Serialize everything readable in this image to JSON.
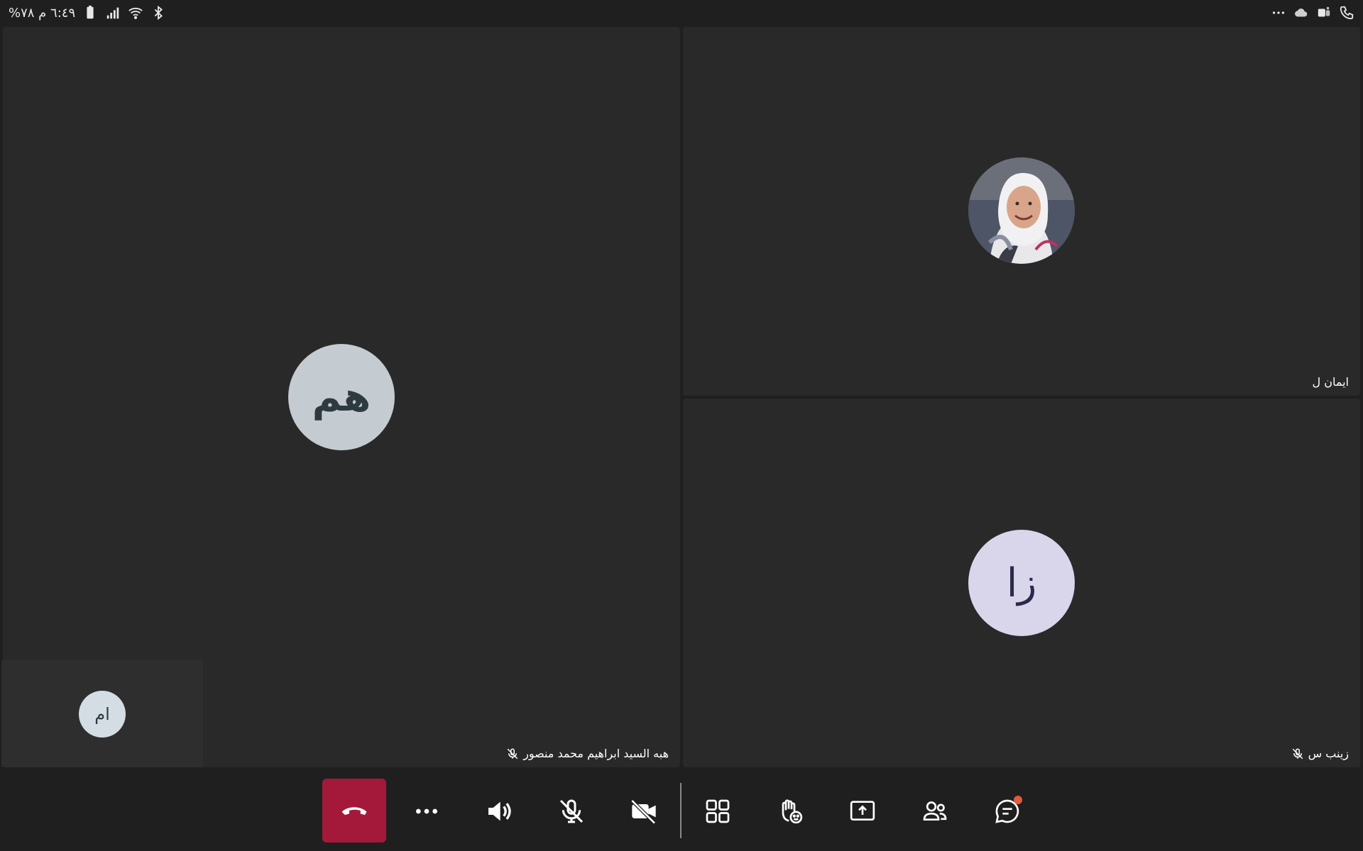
{
  "status_bar": {
    "left_text": "٦:٤٩ م  ٧٨%",
    "icons": [
      "bluetooth-icon",
      "wifi-icon",
      "signal-icon",
      "battery-icon"
    ],
    "right_icons": [
      "phone-icon",
      "teams-icon",
      "cloud-icon",
      "more-icon"
    ]
  },
  "participants": {
    "main": {
      "initials": "هم",
      "name": "هبه السيد ابراهيم محمد منصور",
      "muted": true
    },
    "top_right": {
      "name": "ايمان ل",
      "has_photo": true
    },
    "bottom_right": {
      "initials": "زا",
      "name": "زينب س",
      "muted": true
    },
    "self_view": {
      "initials": "ام"
    }
  },
  "controls": {
    "hangup": "hang-up-icon",
    "buttons": [
      "more-icon",
      "speaker-icon",
      "mic-off-icon",
      "camera-off-icon",
      "layout-grid-icon",
      "raise-hand-icon",
      "share-screen-icon",
      "participants-icon",
      "chat-icon"
    ]
  },
  "colors": {
    "hangup": "#a4193a",
    "avatar_main_bg": "#c4ccd1",
    "avatar_zeinab_bg": "#d9d6ec",
    "avatar_self_bg": "#d3dde3",
    "chat_badge": "#e05b3f"
  }
}
